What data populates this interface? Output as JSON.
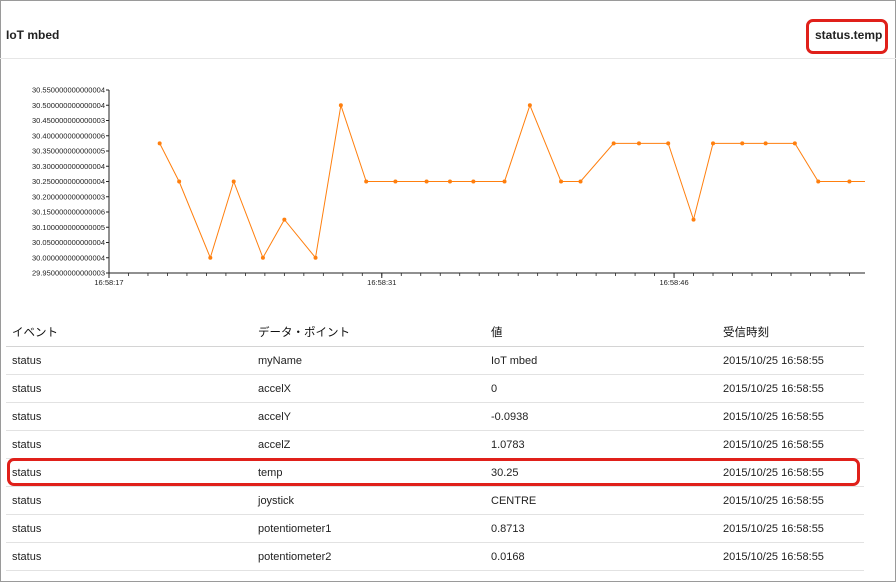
{
  "header": {
    "title": "IoT mbed",
    "datapoint_label": "status.temp"
  },
  "chart_data": {
    "type": "line",
    "color": "#ff7f0e",
    "y_ticks": [
      "30.550000000000004",
      "30.500000000000004",
      "30.450000000000003",
      "30.400000000000006",
      "30.350000000000005",
      "30.300000000000004",
      "30.250000000000004",
      "30.200000000000003",
      "30.150000000000006",
      "30.100000000000005",
      "30.050000000000004",
      "30.000000000000004",
      "29.950000000000003"
    ],
    "ylim": [
      29.95,
      30.55
    ],
    "x_ticks": [
      "16:58:17",
      "16:58:31",
      "16:58:46"
    ],
    "x_range_seconds": [
      0,
      38.8
    ],
    "x_tick_seconds": [
      0,
      14,
      29
    ],
    "points": [
      {
        "t": 2.6,
        "v": 30.375
      },
      {
        "t": 3.6,
        "v": 30.25
      },
      {
        "t": 5.2,
        "v": 30.0
      },
      {
        "t": 6.4,
        "v": 30.25
      },
      {
        "t": 7.9,
        "v": 30.0
      },
      {
        "t": 9.0,
        "v": 30.125
      },
      {
        "t": 10.6,
        "v": 30.0
      },
      {
        "t": 11.9,
        "v": 30.5
      },
      {
        "t": 13.2,
        "v": 30.25
      },
      {
        "t": 14.7,
        "v": 30.25
      },
      {
        "t": 16.3,
        "v": 30.25
      },
      {
        "t": 17.5,
        "v": 30.25
      },
      {
        "t": 18.7,
        "v": 30.25
      },
      {
        "t": 20.3,
        "v": 30.25
      },
      {
        "t": 21.6,
        "v": 30.5
      },
      {
        "t": 23.2,
        "v": 30.25
      },
      {
        "t": 24.2,
        "v": 30.25
      },
      {
        "t": 25.9,
        "v": 30.375
      },
      {
        "t": 27.2,
        "v": 30.375
      },
      {
        "t": 28.7,
        "v": 30.375
      },
      {
        "t": 30.0,
        "v": 30.125
      },
      {
        "t": 31.0,
        "v": 30.375
      },
      {
        "t": 32.5,
        "v": 30.375
      },
      {
        "t": 33.7,
        "v": 30.375
      },
      {
        "t": 35.2,
        "v": 30.375
      },
      {
        "t": 36.4,
        "v": 30.25
      },
      {
        "t": 38.0,
        "v": 30.25
      },
      {
        "t": 38.8,
        "v": 30.25
      }
    ]
  },
  "table": {
    "headers": [
      "イベント",
      "データ・ポイント",
      "値",
      "受信時刻"
    ],
    "rows": [
      [
        "status",
        "myName",
        "IoT mbed",
        "2015/10/25 16:58:55"
      ],
      [
        "status",
        "accelX",
        "0",
        "2015/10/25 16:58:55"
      ],
      [
        "status",
        "accelY",
        "-0.0938",
        "2015/10/25 16:58:55"
      ],
      [
        "status",
        "accelZ",
        "1.0783",
        "2015/10/25 16:58:55"
      ],
      [
        "status",
        "temp",
        "30.25",
        "2015/10/25 16:58:55"
      ],
      [
        "status",
        "joystick",
        "CENTRE",
        "2015/10/25 16:58:55"
      ],
      [
        "status",
        "potentiometer1",
        "0.8713",
        "2015/10/25 16:58:55"
      ],
      [
        "status",
        "potentiometer2",
        "0.0168",
        "2015/10/25 16:58:55"
      ]
    ]
  }
}
